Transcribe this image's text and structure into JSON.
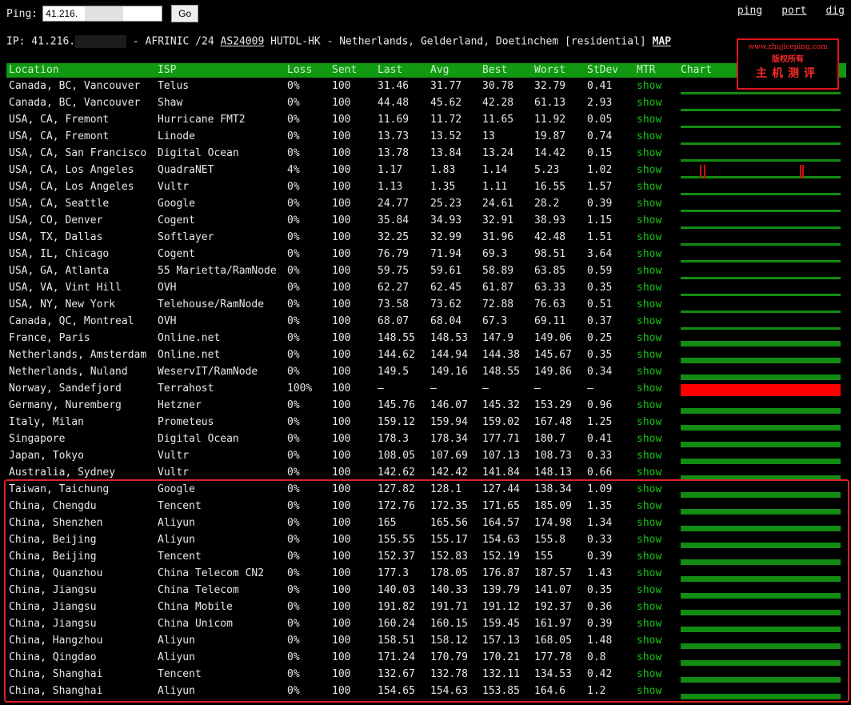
{
  "top": {
    "ping_label": "Ping:",
    "ping_value": "41.216.",
    "go_label": "Go",
    "links": [
      "ping",
      "port",
      "dig"
    ]
  },
  "ipinfo": {
    "prefix": "IP: 41.216.",
    "rest": " - AFRINIC /24 ",
    "asn": "AS24009",
    "desc": " HUTDL-HK - Netherlands, Gelderland, Doetinchem [residential] ",
    "map": "MAP"
  },
  "watermark": {
    "line1": "www.zhujiceping.com",
    "line2": "版权所有",
    "line3": "主机测评"
  },
  "columns": [
    "Location",
    "ISP",
    "Loss",
    "Sent",
    "Last",
    "Avg",
    "Best",
    "Worst",
    "StDev",
    "MTR",
    "Chart"
  ],
  "colors": {
    "header_bg": "#119911",
    "chart_bar": "#128c12",
    "show_link": "#19c319",
    "highlight": "#e0222a",
    "loss_bar": "#ff0000"
  },
  "rows": [
    {
      "loc": "Canada, BC, Vancouver",
      "isp": "Telus",
      "loss": "0%",
      "sent": "100",
      "last": "31.46",
      "avg": "31.77",
      "best": "30.78",
      "worst": "32.79",
      "std": "0.41",
      "mtr": "show"
    },
    {
      "loc": "Canada, BC, Vancouver",
      "isp": "Shaw",
      "loss": "0%",
      "sent": "100",
      "last": "44.48",
      "avg": "45.62",
      "best": "42.28",
      "worst": "61.13",
      "std": "2.93",
      "mtr": "show"
    },
    {
      "loc": "USA, CA, Fremont",
      "isp": "Hurricane FMT2",
      "loss": "0%",
      "sent": "100",
      "last": "11.69",
      "avg": "11.72",
      "best": "11.65",
      "worst": "11.92",
      "std": "0.05",
      "mtr": "show"
    },
    {
      "loc": "USA, CA, Fremont",
      "isp": "Linode",
      "loss": "0%",
      "sent": "100",
      "last": "13.73",
      "avg": "13.52",
      "best": "13",
      "worst": "19.87",
      "std": "0.74",
      "mtr": "show"
    },
    {
      "loc": "USA, CA, San Francisco",
      "isp": "Digital Ocean",
      "loss": "0%",
      "sent": "100",
      "last": "13.78",
      "avg": "13.84",
      "best": "13.24",
      "worst": "14.42",
      "std": "0.15",
      "mtr": "show"
    },
    {
      "loc": "USA, CA, Los Angeles",
      "isp": "QuadraNET",
      "loss": "4%",
      "sent": "100",
      "last": "1.17",
      "avg": "1.83",
      "best": "1.14",
      "worst": "5.23",
      "std": "1.02",
      "mtr": "show"
    },
    {
      "loc": "USA, CA, Los Angeles",
      "isp": "Vultr",
      "loss": "0%",
      "sent": "100",
      "last": "1.13",
      "avg": "1.35",
      "best": "1.11",
      "worst": "16.55",
      "std": "1.57",
      "mtr": "show"
    },
    {
      "loc": "USA, CA, Seattle",
      "isp": "Google",
      "loss": "0%",
      "sent": "100",
      "last": "24.77",
      "avg": "25.23",
      "best": "24.61",
      "worst": "28.2",
      "std": "0.39",
      "mtr": "show"
    },
    {
      "loc": "USA, CO, Denver",
      "isp": "Cogent",
      "loss": "0%",
      "sent": "100",
      "last": "35.84",
      "avg": "34.93",
      "best": "32.91",
      "worst": "38.93",
      "std": "1.15",
      "mtr": "show"
    },
    {
      "loc": "USA, TX, Dallas",
      "isp": "Softlayer",
      "loss": "0%",
      "sent": "100",
      "last": "32.25",
      "avg": "32.99",
      "best": "31.96",
      "worst": "42.48",
      "std": "1.51",
      "mtr": "show"
    },
    {
      "loc": "USA, IL, Chicago",
      "isp": "Cogent",
      "loss": "0%",
      "sent": "100",
      "last": "76.79",
      "avg": "71.94",
      "best": "69.3",
      "worst": "98.51",
      "std": "3.64",
      "mtr": "show"
    },
    {
      "loc": "USA, GA, Atlanta",
      "isp": "55 Marietta/RamNode",
      "loss": "0%",
      "sent": "100",
      "last": "59.75",
      "avg": "59.61",
      "best": "58.89",
      "worst": "63.85",
      "std": "0.59",
      "mtr": "show"
    },
    {
      "loc": "USA, VA, Vint Hill",
      "isp": "OVH",
      "loss": "0%",
      "sent": "100",
      "last": "62.27",
      "avg": "62.45",
      "best": "61.87",
      "worst": "63.33",
      "std": "0.35",
      "mtr": "show"
    },
    {
      "loc": "USA, NY, New York",
      "isp": "Telehouse/RamNode",
      "loss": "0%",
      "sent": "100",
      "last": "73.58",
      "avg": "73.62",
      "best": "72.88",
      "worst": "76.63",
      "std": "0.51",
      "mtr": "show"
    },
    {
      "loc": "Canada, QC, Montreal",
      "isp": "OVH",
      "loss": "0%",
      "sent": "100",
      "last": "68.07",
      "avg": "68.04",
      "best": "67.3",
      "worst": "69.11",
      "std": "0.37",
      "mtr": "show"
    },
    {
      "loc": "France, Paris",
      "isp": "Online.net",
      "loss": "0%",
      "sent": "100",
      "last": "148.55",
      "avg": "148.53",
      "best": "147.9",
      "worst": "149.06",
      "std": "0.25",
      "mtr": "show"
    },
    {
      "loc": "Netherlands, Amsterdam",
      "isp": "Online.net",
      "loss": "0%",
      "sent": "100",
      "last": "144.62",
      "avg": "144.94",
      "best": "144.38",
      "worst": "145.67",
      "std": "0.35",
      "mtr": "show"
    },
    {
      "loc": "Netherlands, Nuland",
      "isp": "WeservIT/RamNode",
      "loss": "0%",
      "sent": "100",
      "last": "149.5",
      "avg": "149.16",
      "best": "148.55",
      "worst": "149.86",
      "std": "0.34",
      "mtr": "show"
    },
    {
      "loc": "Norway, Sandefjord",
      "isp": "Terrahost",
      "loss": "100%",
      "sent": "100",
      "last": "–",
      "avg": "–",
      "best": "–",
      "worst": "–",
      "std": "–",
      "mtr": "show"
    },
    {
      "loc": "Germany, Nuremberg",
      "isp": "Hetzner",
      "loss": "0%",
      "sent": "100",
      "last": "145.76",
      "avg": "146.07",
      "best": "145.32",
      "worst": "153.29",
      "std": "0.96",
      "mtr": "show"
    },
    {
      "loc": "Italy, Milan",
      "isp": "Prometeus",
      "loss": "0%",
      "sent": "100",
      "last": "159.12",
      "avg": "159.94",
      "best": "159.02",
      "worst": "167.48",
      "std": "1.25",
      "mtr": "show"
    },
    {
      "loc": "Singapore",
      "isp": "Digital Ocean",
      "loss": "0%",
      "sent": "100",
      "last": "178.3",
      "avg": "178.34",
      "best": "177.71",
      "worst": "180.7",
      "std": "0.41",
      "mtr": "show"
    },
    {
      "loc": "Japan, Tokyo",
      "isp": "Vultr",
      "loss": "0%",
      "sent": "100",
      "last": "108.05",
      "avg": "107.69",
      "best": "107.13",
      "worst": "108.73",
      "std": "0.33",
      "mtr": "show"
    },
    {
      "loc": "Australia, Sydney",
      "isp": "Vultr",
      "loss": "0%",
      "sent": "100",
      "last": "142.62",
      "avg": "142.42",
      "best": "141.84",
      "worst": "148.13",
      "std": "0.66",
      "mtr": "show"
    },
    {
      "loc": "Taiwan, Taichung",
      "isp": "Google",
      "loss": "0%",
      "sent": "100",
      "last": "127.82",
      "avg": "128.1",
      "best": "127.44",
      "worst": "138.34",
      "std": "1.09",
      "mtr": "show"
    },
    {
      "loc": "China, Chengdu",
      "isp": "Tencent",
      "loss": "0%",
      "sent": "100",
      "last": "172.76",
      "avg": "172.35",
      "best": "171.65",
      "worst": "185.09",
      "std": "1.35",
      "mtr": "show"
    },
    {
      "loc": "China, Shenzhen",
      "isp": "Aliyun",
      "loss": "0%",
      "sent": "100",
      "last": "165",
      "avg": "165.56",
      "best": "164.57",
      "worst": "174.98",
      "std": "1.34",
      "mtr": "show"
    },
    {
      "loc": "China, Beijing",
      "isp": "Aliyun",
      "loss": "0%",
      "sent": "100",
      "last": "155.55",
      "avg": "155.17",
      "best": "154.63",
      "worst": "155.8",
      "std": "0.33",
      "mtr": "show"
    },
    {
      "loc": "China, Beijing",
      "isp": "Tencent",
      "loss": "0%",
      "sent": "100",
      "last": "152.37",
      "avg": "152.83",
      "best": "152.19",
      "worst": "155",
      "std": "0.39",
      "mtr": "show"
    },
    {
      "loc": "China, Quanzhou",
      "isp": "China Telecom CN2",
      "loss": "0%",
      "sent": "100",
      "last": "177.3",
      "avg": "178.05",
      "best": "176.87",
      "worst": "187.57",
      "std": "1.43",
      "mtr": "show"
    },
    {
      "loc": "China, Jiangsu",
      "isp": "China Telecom",
      "loss": "0%",
      "sent": "100",
      "last": "140.03",
      "avg": "140.33",
      "best": "139.79",
      "worst": "141.07",
      "std": "0.35",
      "mtr": "show"
    },
    {
      "loc": "China, Jiangsu",
      "isp": "China Mobile",
      "loss": "0%",
      "sent": "100",
      "last": "191.82",
      "avg": "191.71",
      "best": "191.12",
      "worst": "192.37",
      "std": "0.36",
      "mtr": "show"
    },
    {
      "loc": "China, Jiangsu",
      "isp": "China Unicom",
      "loss": "0%",
      "sent": "100",
      "last": "160.24",
      "avg": "160.15",
      "best": "159.45",
      "worst": "161.97",
      "std": "0.39",
      "mtr": "show"
    },
    {
      "loc": "China, Hangzhou",
      "isp": "Aliyun",
      "loss": "0%",
      "sent": "100",
      "last": "158.51",
      "avg": "158.12",
      "best": "157.13",
      "worst": "168.05",
      "std": "1.48",
      "mtr": "show"
    },
    {
      "loc": "China, Qingdao",
      "isp": "Aliyun",
      "loss": "0%",
      "sent": "100",
      "last": "171.24",
      "avg": "170.79",
      "best": "170.21",
      "worst": "177.78",
      "std": "0.8",
      "mtr": "show"
    },
    {
      "loc": "China, Shanghai",
      "isp": "Tencent",
      "loss": "0%",
      "sent": "100",
      "last": "132.67",
      "avg": "132.78",
      "best": "132.11",
      "worst": "134.53",
      "std": "0.42",
      "mtr": "show"
    },
    {
      "loc": "China, Shanghai",
      "isp": "Aliyun",
      "loss": "0%",
      "sent": "100",
      "last": "154.65",
      "avg": "154.63",
      "best": "153.85",
      "worst": "164.6",
      "std": "1.2",
      "mtr": "show"
    }
  ]
}
